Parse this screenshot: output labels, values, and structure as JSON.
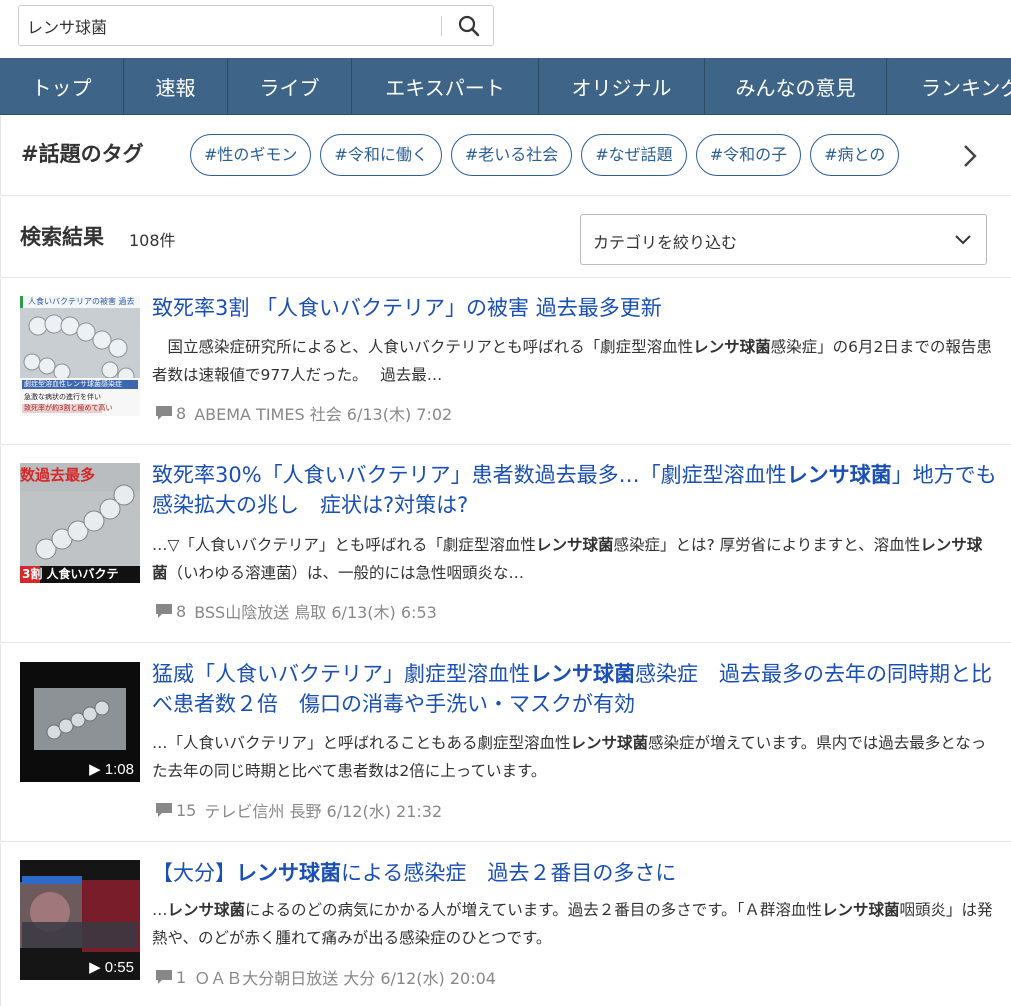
{
  "search": {
    "value": "レンサ球菌"
  },
  "nav": [
    "トップ",
    "速報",
    "ライブ",
    "エキスパート",
    "オリジナル",
    "みんなの意見",
    "ランキング"
  ],
  "tags": {
    "title": "#話題のタグ",
    "items": [
      "#性のギモン",
      "#令和に働く",
      "#老いる社会",
      "#なぜ話題",
      "#令和の子",
      "#病との"
    ]
  },
  "results": {
    "title": "検索結果",
    "count": "108件",
    "category_select": "カテゴリを絞り込む"
  },
  "articles": [
    {
      "thumb_caption_top": "人食いバクテリアの被害 過去",
      "thumb_caption_bottom": [
        "劇症型溶血性レンサ球菌感染症",
        "急激な病状の進行を伴い",
        "致死率が約3割と極めて高い"
      ],
      "title_parts": [
        "致死率3割 「人食いバクテリア」の被害 過去最多更新"
      ],
      "snippet": [
        "　国立感染症研究所によると、人食いバクテリアとも呼ばれる「劇症型溶血性",
        "レンサ球菌",
        "感染症」の6月2日までの報告患者数は速報値で977人だった。　 過去最…"
      ],
      "comments": "8",
      "meta": "ABEMA TIMES 社会 6/13(木) 7:02"
    },
    {
      "thumb_caption_top": "数過去最多",
      "thumb_caption_bottom": [
        "3割 人食いバクテ"
      ],
      "title_parts": [
        "致死率30%「人食いバクテリア」患者数過去最多…「劇症型溶血性",
        "レンサ球菌",
        "」地方でも感染拡大の兆し　症状は?対策は?"
      ],
      "snippet": [
        "…▽「人食いバクテリア」とも呼ばれる「劇症型溶血性",
        "レンサ球菌",
        "感染症」とは? 厚労省によりますと、溶血性",
        "レンサ球菌",
        "（いわゆる溶連菌）は、一般的には急性咽頭炎な…"
      ],
      "comments": "8",
      "meta": "BSS山陰放送 鳥取 6/13(木) 6:53"
    },
    {
      "duration": "▶ 1:08",
      "title_parts": [
        "猛威「人食いバクテリア」劇症型溶血性",
        "レンサ球菌",
        "感染症　過去最多の去年の同時期と比べ患者数２倍　傷口の消毒や手洗い・マスクが有効"
      ],
      "snippet": [
        "…「人食いバクテリア」と呼ばれることもある劇症型溶血性",
        "レンサ球菌",
        "感染症が増えています。県内では過去最多となった去年の同じ時期と比べて患者数は2倍に上っています。"
      ],
      "comments": "15",
      "meta": "テレビ信州 長野 6/12(水) 21:32"
    },
    {
      "duration": "▶ 0:55",
      "title_parts": [
        "【大分】",
        "レンサ球菌",
        "による感染症　過去２番目の多さに"
      ],
      "snippet": [
        "…",
        "レンサ球菌",
        "によるのどの病気にかかる人が増えています。過去２番目の多さです。「Ａ群溶血性",
        "レンサ球菌",
        "咽頭炎」は発熱や、のどが赤く腫れて痛みが出る感染症のひとつです。"
      ],
      "comments": "1",
      "meta": "ＯＡＢ大分朝日放送 大分 6/12(水) 20:04"
    }
  ],
  "colors": {
    "nav_bg": "#3e6488",
    "link": "#1a4fb5",
    "tag": "#2b5f9a"
  }
}
